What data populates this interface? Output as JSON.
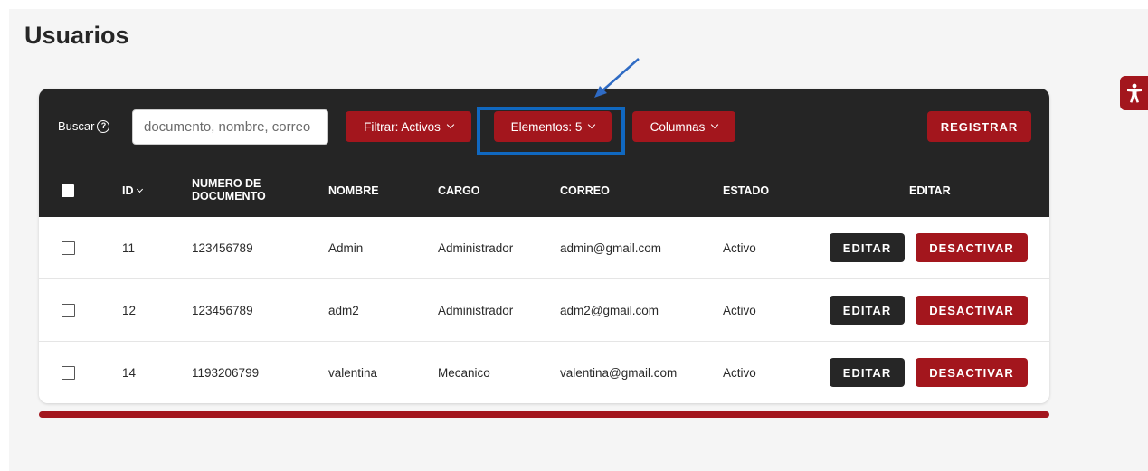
{
  "page": {
    "title": "Usuarios"
  },
  "toolbar": {
    "search_label": "Buscar",
    "search_placeholder": "documento, nombre, correo",
    "filter_label": "Filtrar: Activos",
    "elements_label": "Elementos: 5",
    "columns_label": "Columnas",
    "register_label": "REGISTRAR"
  },
  "table": {
    "headers": {
      "id": "ID",
      "documento": "NUMERO DE DOCUMENTO",
      "nombre": "NOMBRE",
      "cargo": "CARGO",
      "correo": "CORREO",
      "estado": "ESTADO",
      "editar": "EDITAR"
    },
    "rows": [
      {
        "id": "11",
        "documento": "123456789",
        "nombre": "Admin",
        "cargo": "Administrador",
        "correo": "admin@gmail.com",
        "estado": "Activo",
        "edit_label": "EDITAR",
        "deactivate_label": "DESACTIVAR"
      },
      {
        "id": "12",
        "documento": "123456789",
        "nombre": "adm2",
        "cargo": "Administrador",
        "correo": "adm2@gmail.com",
        "estado": "Activo",
        "edit_label": "EDITAR",
        "deactivate_label": "DESACTIVAR"
      },
      {
        "id": "14",
        "documento": "1193206799",
        "nombre": "valentina",
        "cargo": "Mecanico",
        "correo": "valentina@gmail.com",
        "estado": "Activo",
        "edit_label": "EDITAR",
        "deactivate_label": "DESACTIVAR"
      }
    ]
  },
  "colors": {
    "accent": "#a3161d",
    "header_bg": "#252525",
    "highlight": "#1068c0"
  },
  "icons": {
    "help": "question-circle-icon",
    "chevron": "chevron-down-icon",
    "accessibility": "accessibility-icon",
    "annotation_arrow": "arrow-icon"
  }
}
